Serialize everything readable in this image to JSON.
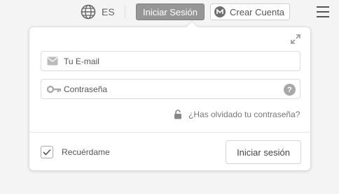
{
  "topbar": {
    "language_code": "ES",
    "login_button": "Iniciar Sesión",
    "create_account_button": "Crear Cuenta",
    "icons": [
      "globe-icon",
      "mega-logo-icon",
      "hamburger-menu-icon"
    ]
  },
  "login_form": {
    "email_placeholder": "Tu E-mail",
    "password_placeholder": "Contraseña",
    "help_symbol": "?",
    "forgot_password": "¿Has olvidado tu contraseña?",
    "remember_me": "Recuérdame",
    "remember_checked": true,
    "submit_button": "Iniciar sesión",
    "icons": [
      "expand-icon",
      "email-icon",
      "key-icon",
      "help-icon",
      "lock-icon",
      "checkmark-icon"
    ]
  },
  "colors": {
    "background": "#f4f4f4",
    "login_button_bg": "#969696",
    "text": "#444444"
  }
}
